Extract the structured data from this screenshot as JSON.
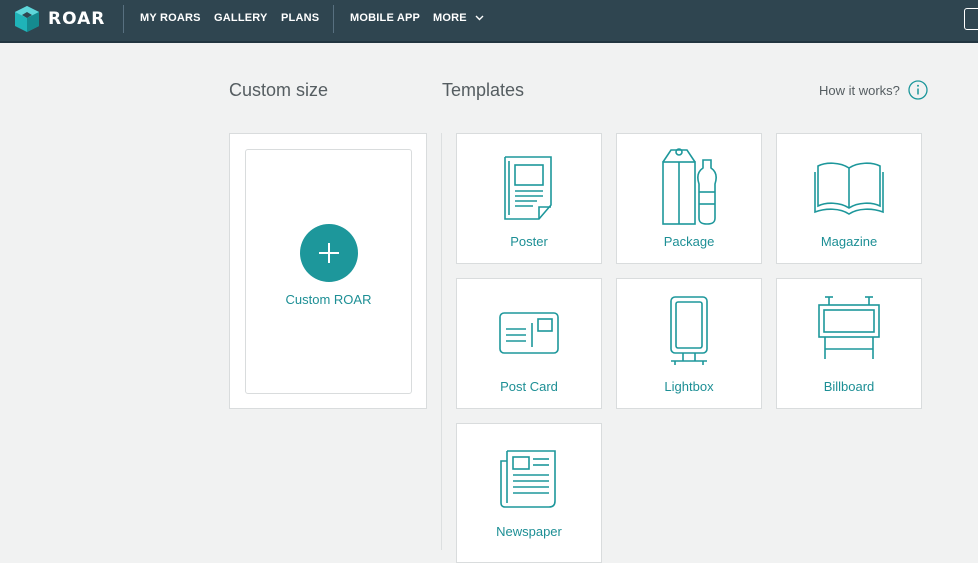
{
  "header": {
    "logo_text": "ROAR",
    "nav": [
      {
        "label": "MY ROARS"
      },
      {
        "label": "GALLERY"
      },
      {
        "label": "PLANS"
      },
      {
        "label": "MOBILE APP"
      },
      {
        "label": "MORE"
      }
    ]
  },
  "custom_size": {
    "heading": "Custom size",
    "button_label": "Custom ROAR"
  },
  "templates": {
    "heading": "Templates",
    "how_it_works": "How it works?",
    "items": [
      {
        "label": "Poster",
        "icon": "poster-icon"
      },
      {
        "label": "Package",
        "icon": "package-icon"
      },
      {
        "label": "Magazine",
        "icon": "magazine-icon"
      },
      {
        "label": "Post Card",
        "icon": "postcard-icon"
      },
      {
        "label": "Lightbox",
        "icon": "lightbox-icon"
      },
      {
        "label": "Billboard",
        "icon": "billboard-icon"
      },
      {
        "label": "Newspaper",
        "icon": "newspaper-icon"
      }
    ]
  },
  "colors": {
    "nav_bg": "#2f4550",
    "accent": "#1d979b",
    "page_bg": "#f1f2f2"
  }
}
